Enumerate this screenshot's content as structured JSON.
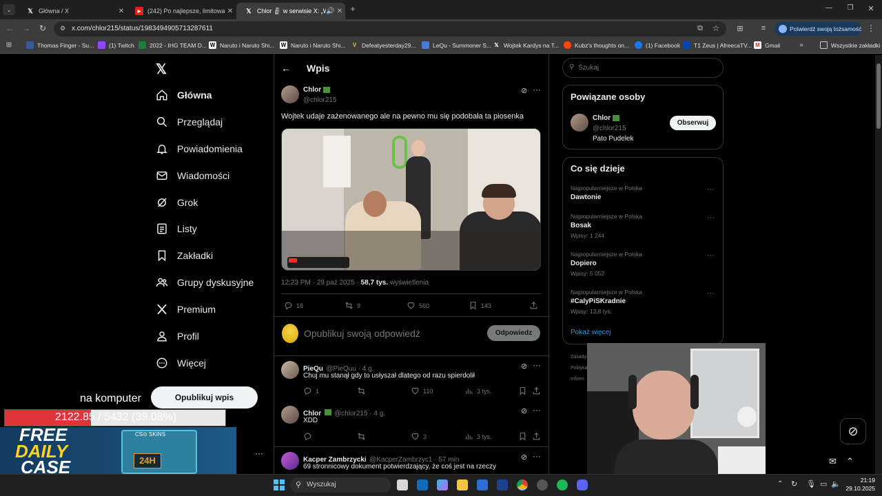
{
  "browser": {
    "tabs": [
      {
        "title": "Główna / X"
      },
      {
        "title": "(242) Po najlepsze, limitowane"
      },
      {
        "title": "Chlor 🗿 w serwisie X: „Wo"
      }
    ],
    "url": "x.com/chlor215/status/1983494905713287611",
    "verify_label": "Potwierdź swoją tożsamość",
    "bookmarks": [
      {
        "label": "Thomas Finger - Su..."
      },
      {
        "label": "(1) Twitch"
      },
      {
        "label": "2022 - IHG TEAM D..."
      },
      {
        "label": "Naruto i Naruto Shi..."
      },
      {
        "label": "Naruto i Naruto Shi..."
      },
      {
        "label": "Defeatyesterday29..."
      },
      {
        "label": "LeQu - Summoner S..."
      },
      {
        "label": "Wojtek Kardys na T..."
      },
      {
        "label": "Kubz's thoughts on..."
      },
      {
        "label": "(1) Facebook"
      },
      {
        "label": "T1 Zeus | AfreecaTV..."
      },
      {
        "label": "Gmail"
      }
    ],
    "all_bookmarks": "Wszystkie zakładki"
  },
  "nav": {
    "items": [
      {
        "label": "Główna",
        "icon": "home-icon"
      },
      {
        "label": "Przeglądaj",
        "icon": "search-icon"
      },
      {
        "label": "Powiadomienia",
        "icon": "bell-icon"
      },
      {
        "label": "Wiadomości",
        "icon": "mail-icon"
      },
      {
        "label": "Grok",
        "icon": "grok-icon"
      },
      {
        "label": "Listy",
        "icon": "list-icon"
      },
      {
        "label": "Zakładki",
        "icon": "bookmark-icon"
      },
      {
        "label": "Grupy dyskusyjne",
        "icon": "people-icon"
      },
      {
        "label": "Premium",
        "icon": "x-icon"
      },
      {
        "label": "Profil",
        "icon": "person-icon"
      },
      {
        "label": "Więcej",
        "icon": "more-icon"
      }
    ],
    "post_button": "Opublikuj wpis"
  },
  "post": {
    "header": "Wpis",
    "author_name": "Chlor",
    "author_handle": "@chlor215",
    "text": "Wojtek udaje zażenowanego ale na pewno mu się podobała ta piosenka",
    "time": "12:23 PM · 29 paź 2025 · ",
    "views": "58,7 tys.",
    "views_label": " wyświetlenia",
    "replies": "18",
    "reposts": "9",
    "likes": "560",
    "bookmarks": "143",
    "reply_placeholder": "Opublikuj swoją odpowiedź",
    "reply_button": "Odpowiedz"
  },
  "replies": [
    {
      "name": "PieQu",
      "handle": "@PieQuu · 4 g.",
      "text": "Chuj mu stanął gdy to usłyszał dlatego od razu spierdolił",
      "replies": "1",
      "reposts": "",
      "likes": "110",
      "views": "3 tys."
    },
    {
      "name": "Chlor",
      "handle": "@chlor215 · 4 g.",
      "text": "XDD",
      "replies": "",
      "reposts": "",
      "likes": "3",
      "views": "3 tys."
    },
    {
      "name": "Kacper Zambrzycki",
      "handle": "@KacperZambrzyc1 · 57 min",
      "text": "69 stronnicowy dokument potwierdzający, że coś jest na rzeczy"
    }
  ],
  "right": {
    "search_placeholder": "Szukaj",
    "related_title": "Powiązane osoby",
    "related_name": "Chlor",
    "related_handle": "@chlor215",
    "related_bio": "Pato Pudelek",
    "follow_button": "Obserwuj",
    "trends_title": "Co się dzieje",
    "trends": [
      {
        "meta": "Najpopularniejsze w Polska",
        "name": "Dawtonie",
        "count": ""
      },
      {
        "meta": "Najpopularniejsze w Polska",
        "name": "Bosak",
        "count": "Wpisy: 1 244"
      },
      {
        "meta": "Najpopularniejsze w Polska",
        "name": "Dopiero",
        "count": "Wpisy: 5 052"
      },
      {
        "meta": "Najpopularniejsze w Polska",
        "name": "#CalyPiSKradnie",
        "count": "Wpisy: 13,8 tys."
      }
    ],
    "show_more": "Pokaż więcej",
    "footer_1": "Zasady",
    "footer_2": "Polityka",
    "footer_3": "Inform"
  },
  "overlay": {
    "caption": "na komputer",
    "progress_text": "2122.85 / 5432 (39.08%)",
    "progress_fraction": 0.3908,
    "ad_line1": "FREE",
    "ad_line2": "DAILY",
    "ad_line3": "CASE",
    "ad_badge": "24H",
    "ad_brand": "CS⊙ SKINS"
  },
  "taskbar": {
    "search_placeholder": "Wyszukaj",
    "time": "21:19",
    "date": "29.10.2025"
  }
}
